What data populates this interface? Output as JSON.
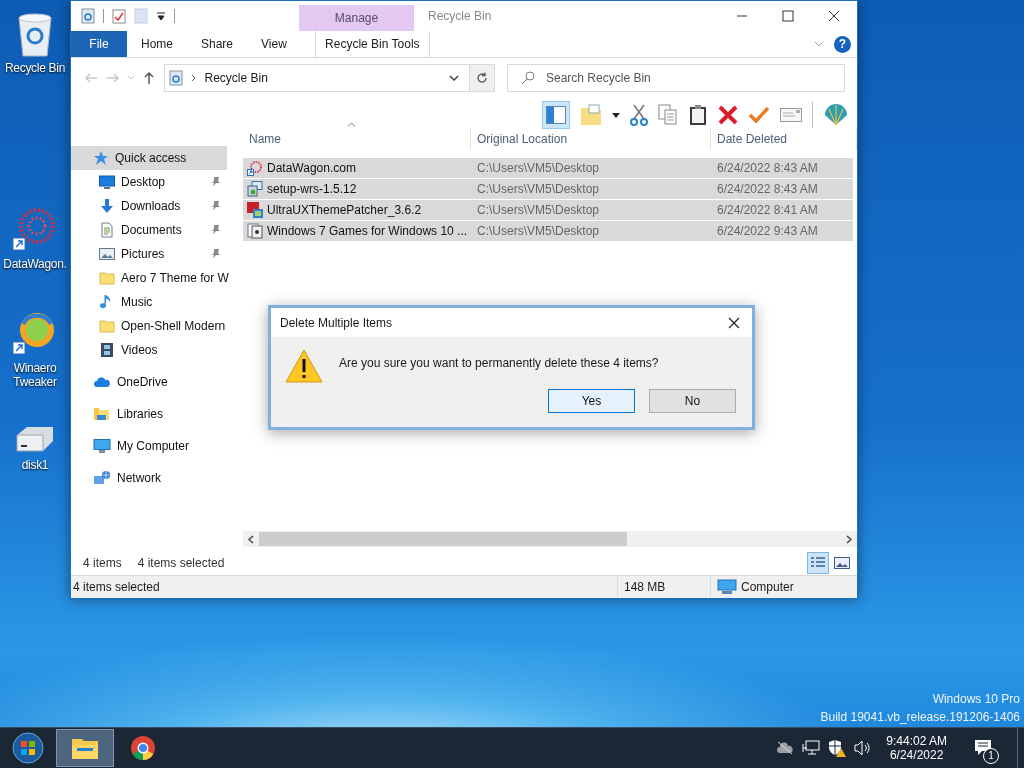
{
  "desktop_icons": [
    {
      "label": "Recycle Bin",
      "kind": "recycle"
    },
    {
      "label": "DataWagon.",
      "kind": "web-shortcut"
    },
    {
      "label": "Winaero Tweaker",
      "kind": "app-shortcut"
    },
    {
      "label": "disk1",
      "kind": "drive"
    }
  ],
  "window": {
    "title": "Recycle Bin",
    "context_header": "Manage",
    "help_label": "?",
    "ribbon_tabs": [
      {
        "label": "File",
        "kind": "file"
      },
      {
        "label": "Home",
        "kind": "tab"
      },
      {
        "label": "Share",
        "kind": "tab"
      },
      {
        "label": "View",
        "kind": "tab"
      },
      {
        "label": "Recycle Bin Tools",
        "kind": "contextual"
      }
    ],
    "address": {
      "path": "Recycle Bin"
    },
    "search": {
      "placeholder": "Search Recycle Bin"
    },
    "toolbar": {
      "pane_toggle_on": true
    },
    "navigation": [
      {
        "label": "Quick access",
        "kind": "star",
        "selected": true,
        "children": [
          {
            "label": "Desktop",
            "kind": "desktop",
            "selected": false,
            "pinned": true
          },
          {
            "label": "Downloads",
            "kind": "downloads",
            "selected": false,
            "pinned": true
          },
          {
            "label": "Documents",
            "kind": "documents",
            "selected": false,
            "pinned": true
          },
          {
            "label": "Pictures",
            "kind": "pictures",
            "selected": false,
            "pinned": true
          },
          {
            "label": "Aero 7 Theme for W",
            "kind": "folder",
            "selected": false,
            "pinned": false
          },
          {
            "label": "Music",
            "kind": "music",
            "selected": false,
            "pinned": false
          },
          {
            "label": "Open-Shell Modern",
            "kind": "folder",
            "selected": false,
            "pinned": false
          },
          {
            "label": "Videos",
            "kind": "videos",
            "selected": false,
            "pinned": false
          }
        ]
      },
      {
        "label": "OneDrive",
        "kind": "cloud",
        "selected": false
      },
      {
        "label": "Libraries",
        "kind": "libraries",
        "selected": false
      },
      {
        "label": "My Computer",
        "kind": "computer",
        "selected": false
      },
      {
        "label": "Network",
        "kind": "network",
        "selected": false
      }
    ],
    "columns": [
      {
        "label": "Name",
        "sorted": true
      },
      {
        "label": "Original Location",
        "sorted": false
      },
      {
        "label": "Date Deleted",
        "sorted": false
      }
    ],
    "files": [
      {
        "name": "DataWagon.com",
        "location": "C:\\Users\\VM5\\Desktop",
        "date": "6/24/2022 8:43 AM",
        "kind": "web-shortcut",
        "selected": true
      },
      {
        "name": "setup-wrs-1.5.12",
        "location": "C:\\Users\\VM5\\Desktop",
        "date": "6/24/2022 8:43 AM",
        "kind": "installer",
        "selected": true
      },
      {
        "name": "UltraUXThemePatcher_3.6.2",
        "location": "C:\\Users\\VM5\\Desktop",
        "date": "6/24/2022 8:41 AM",
        "kind": "app",
        "selected": true
      },
      {
        "name": "Windows 7 Games for Windows 10 ...",
        "location": "C:\\Users\\VM5\\Desktop",
        "date": "6/24/2022 9:43 AM",
        "kind": "game",
        "selected": true
      }
    ],
    "list_status": {
      "count": "4 items",
      "selection": "4 items selected"
    },
    "view_buttons": [
      {
        "kind": "details",
        "selected": true
      },
      {
        "kind": "large-icons",
        "selected": false
      }
    ],
    "status_bar": {
      "text": "4 items selected",
      "size": "148 MB",
      "location": "Computer"
    }
  },
  "dialog": {
    "title": "Delete Multiple Items",
    "message": "Are you sure you want to permanently delete these 4 items?",
    "buttons": [
      {
        "label": "Yes",
        "default": true
      },
      {
        "label": "No",
        "default": false
      }
    ]
  },
  "os_watermark": {
    "edition": "Windows 10 Pro",
    "build": "Build 19041.vb_release.191206-1406"
  },
  "taskbar": {
    "apps": [
      {
        "kind": "explorer",
        "active": true
      },
      {
        "kind": "chrome",
        "active": false
      }
    ],
    "clock": {
      "time": "9:44:02 AM",
      "date": "6/24/2022"
    },
    "notifications": {
      "badge": "1"
    }
  }
}
